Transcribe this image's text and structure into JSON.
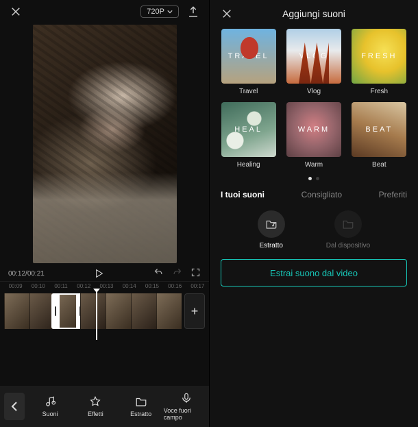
{
  "left": {
    "resolution": "720P",
    "time_current": "00:12",
    "time_total": "00:21",
    "ruler": [
      "00:09",
      "00:10",
      "00:11",
      "00:12",
      "00:13",
      "00:14",
      "00:15",
      "00:16",
      "00:17"
    ],
    "add_label": "+",
    "tools": {
      "back": "‹",
      "sounds": "Suoni",
      "effects": "Effetti",
      "extract": "Estratto",
      "voiceover": "Voce fuori campo"
    }
  },
  "right": {
    "title": "Aggiungi suoni",
    "genres": [
      {
        "overlay": "TRAVEL",
        "label": "Travel",
        "cls": "g-travel"
      },
      {
        "overlay": "VLOG",
        "label": "Vlog",
        "cls": "g-vlog"
      },
      {
        "overlay": "FRESH",
        "label": "Fresh",
        "cls": "g-fresh"
      },
      {
        "overlay": "HEAL",
        "label": "Healing",
        "cls": "g-heal"
      },
      {
        "overlay": "WARM",
        "label": "Warm",
        "cls": "g-warm"
      },
      {
        "overlay": "BEAT",
        "label": "Beat",
        "cls": "g-beat"
      }
    ],
    "tabs": {
      "mine": "I tuoi suoni",
      "recommended": "Consigliato",
      "favorites": "Preferiti"
    },
    "sources": {
      "extracted": "Estratto",
      "device": "Dal dispositivo"
    },
    "extract_button": "Estrai suono dal video"
  }
}
